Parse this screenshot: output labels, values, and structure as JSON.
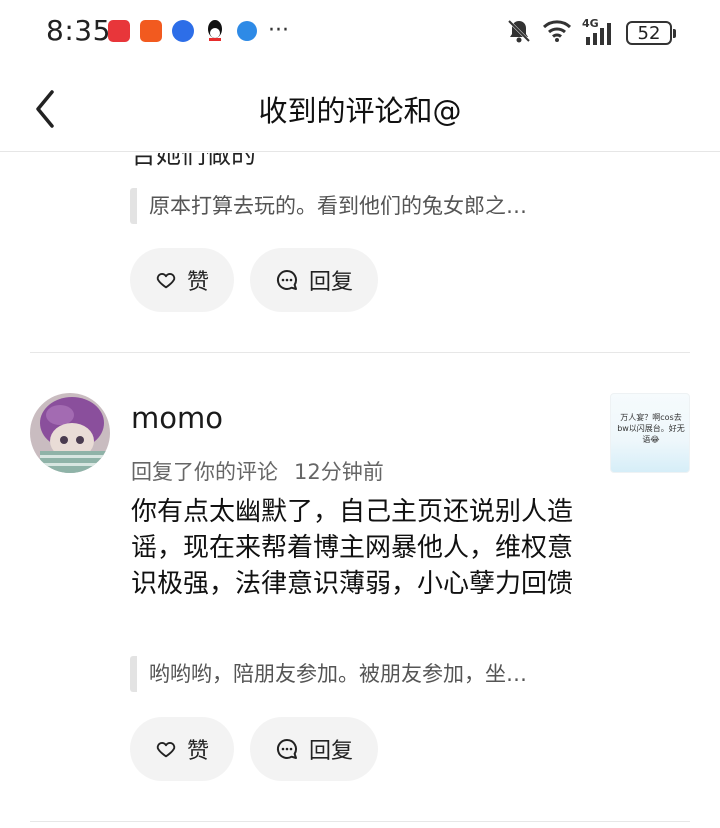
{
  "status_bar": {
    "time": "8:35",
    "more_label": "···",
    "network_label": "4G",
    "battery": "52",
    "app_icons": [
      "news-app-icon",
      "shopping-app-icon",
      "maps-app-icon",
      "qq-icon",
      "browser-icon"
    ],
    "icons": [
      "mute-bell-icon",
      "wifi-icon",
      "signal-icon"
    ]
  },
  "nav": {
    "title": "收到的评论和@",
    "back_icon": "chevron-left-icon"
  },
  "items": [
    {
      "cut_text": "告她们做的",
      "quote": "原本打算去玩的。看到他们的兔女郎之…",
      "like_label": "赞",
      "reply_label": "回复"
    },
    {
      "username": "momo",
      "action": "回复了你的评论",
      "time_ago": "12分钟前",
      "text": "你有点太幽默了，自己主页还说别人造谣，现在来帮着博主网暴他人，维权意识极强，法律意识薄弱，小心孽力回馈",
      "quote": "哟哟哟，陪朋友参加。被朋友参加，坐…",
      "thumb_text": "万人宴？啊cos去bw以闪展台。好无语😂",
      "like_label": "赞",
      "reply_label": "回复"
    }
  ],
  "colors": {
    "pill_bg": "#f3f3f3",
    "quote_bar": "#e3e3e3",
    "divider": "#e7e7e7",
    "avatar_hair": "#8a4f9c"
  }
}
